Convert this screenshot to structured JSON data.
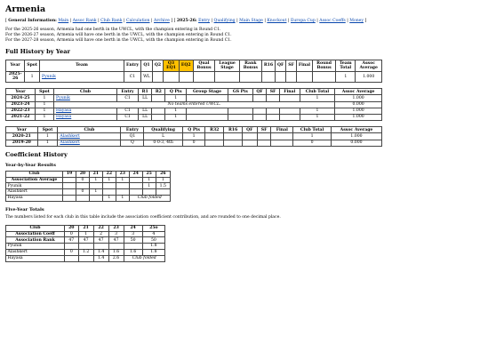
{
  "title": "Armenia",
  "nav": {
    "open": "[",
    "general_label": "General Information:",
    "general_links": [
      "Main",
      "Assoc Rank",
      "Club Rank",
      "Calculation",
      "Archive"
    ],
    "close": "]",
    "season_label": "2025-26:",
    "season_links": [
      "Entry",
      "Qualifying",
      "Main Stage",
      "Knockout",
      "Europa Cup",
      "Assoc Coeffs",
      "Money"
    ],
    "sep": "|"
  },
  "paragraphs": [
    "For the 2025-26 season, Armenia had one berth in the UWCL, with the champion entering in Round C1.",
    "For the 2026-27 season, Armenia will have one berth in the UWCL, with the champion entering in Round C1.",
    "For the 2027-28 season, Armenia will have one berth in the UWCL, with the champion entering in Round C1."
  ],
  "full_history_heading": "Full History by Year",
  "table1": {
    "headers": [
      "Year",
      "Spot",
      "Team",
      "Entry",
      "Q1",
      "Q2",
      "Q3 EQ1",
      "EQ2",
      "Qual Bonus",
      "League Stage",
      "Rank Bonus",
      "R16",
      "QF",
      "SF",
      "Final",
      "Round Bonus",
      "Team Total",
      "Assoc Average"
    ],
    "rows": [
      [
        "2025-26",
        "1",
        "Pyunik",
        "C1",
        "WL",
        "",
        "",
        "",
        "",
        "",
        "",
        "",
        "",
        "",
        "",
        "",
        "1",
        "1.000"
      ]
    ]
  },
  "table2": {
    "headers": [
      "Year",
      "Spot",
      "Club",
      "Entry",
      "R1",
      "R2",
      "Q Pts",
      "Group Stage",
      "GS Pts",
      "QF",
      "SF",
      "Final",
      "Club Total",
      "Assoc Average"
    ],
    "rows": [
      [
        "2024-25",
        "1",
        "Pyunik",
        "C1",
        "LL",
        "",
        "1",
        "",
        "",
        "",
        "",
        "",
        "1",
        "1.000"
      ],
      [
        "2023-24",
        "1",
        "",
        "",
        "",
        "",
        "",
        "",
        "",
        "",
        "",
        "",
        "",
        "0.000"
      ],
      [
        "2022-23",
        "1",
        "Hayasa",
        "C1",
        "LL",
        "",
        "1",
        "",
        "",
        "",
        "",
        "",
        "1",
        "1.000"
      ],
      [
        "2021-22",
        "1",
        "Hayasa",
        "C1",
        "LL",
        "",
        "1",
        "",
        "",
        "",
        "",
        "",
        "1",
        "1.000"
      ]
    ],
    "no_teams_note": "No teams entered UWCL."
  },
  "table3": {
    "headers": [
      "Year",
      "Spot",
      "Club",
      "Entry",
      "Qualifying",
      "Q Pts",
      "R32",
      "R16",
      "QF",
      "SF",
      "Final",
      "Club Total",
      "Assoc Average"
    ],
    "rows": [
      [
        "2020-21",
        "1",
        "Alashkert",
        "Q1",
        "L",
        "1",
        "",
        "",
        "",
        "",
        "",
        "1",
        "1.000"
      ],
      [
        "2019-20",
        "1",
        "Alashkert",
        "Q",
        "0-0-3, 4th",
        "0",
        "",
        "",
        "",
        "",
        "",
        "0",
        "0.000"
      ]
    ]
  },
  "coeff_heading": "Coefficient History",
  "yby_heading": "Year-by-Year Results",
  "table4": {
    "headers": [
      "Club",
      "19",
      "20",
      "21",
      "22",
      "23",
      "24",
      "25",
      "26"
    ],
    "rows": [
      [
        "Association Average",
        "",
        "0",
        "1",
        "1",
        "1",
        "",
        "1",
        "1"
      ],
      [
        "Pyunik",
        "",
        "",
        "",
        "",
        "",
        "",
        "1",
        "1.5"
      ],
      [
        "Alashkert",
        "",
        "0",
        "1",
        "",
        "",
        "",
        "",
        ""
      ],
      [
        "Hayasa",
        "",
        "",
        "",
        "1",
        "1",
        "Club folded",
        "",
        ""
      ]
    ]
  },
  "five_year_heading": "Five-Year Totals",
  "five_year_note": "The numbers listed for each club in this table include the association coefficient contribution, and are rounded to one decimal place.",
  "table5": {
    "headers": [
      "Club",
      "20",
      "21",
      "22",
      "23",
      "24",
      "25o"
    ],
    "rows": [
      [
        "Association Coeff",
        "0",
        "1",
        "2",
        "3",
        "3",
        "4"
      ],
      [
        "Association Rank",
        "47",
        "47",
        "47",
        "47",
        "50",
        "50"
      ],
      [
        "Pyunik",
        "",
        "",
        "",
        "",
        "",
        "1.8"
      ],
      [
        "Alashkert",
        "0",
        "1.2",
        "1.4",
        "1.6",
        "1.6",
        "1.8"
      ],
      [
        "Hayasa",
        "",
        "",
        "1.4",
        "2.6",
        "Club folded",
        ""
      ]
    ]
  }
}
